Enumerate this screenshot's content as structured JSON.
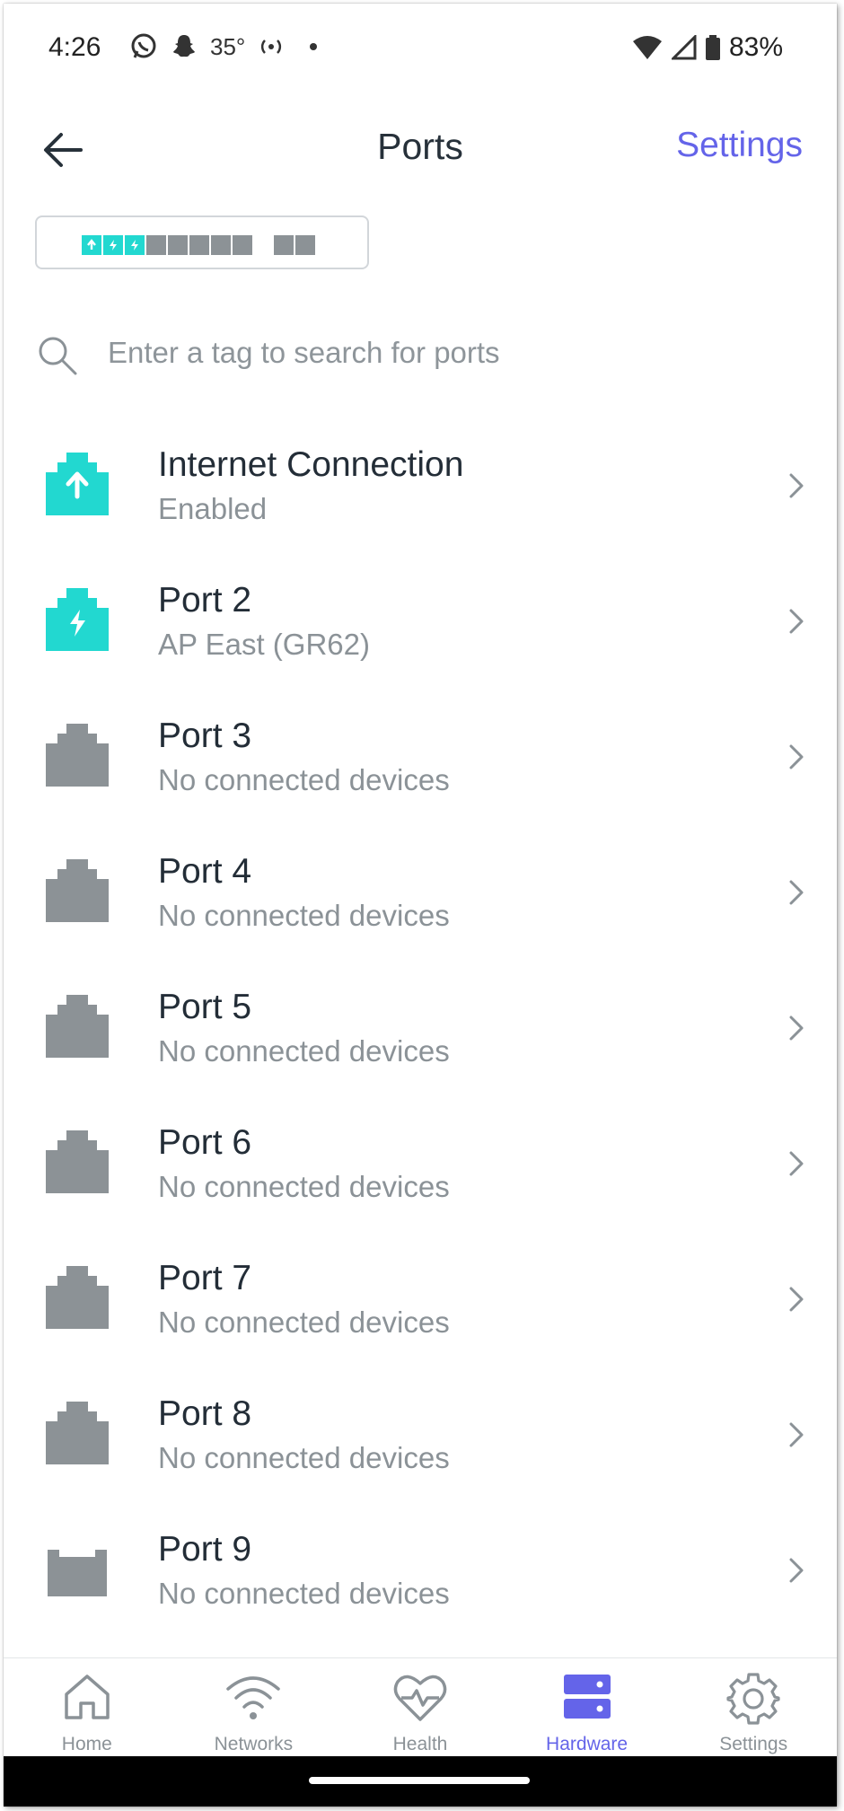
{
  "status_bar": {
    "time": "4:26",
    "temperature": "35°",
    "battery": "83%"
  },
  "header": {
    "title": "Ports",
    "settings_label": "Settings"
  },
  "port_strip": {
    "active_ports": [
      "upload",
      "power",
      "power"
    ],
    "inactive_count": 5,
    "extra_count": 2
  },
  "search": {
    "placeholder": "Enter a tag to search for ports"
  },
  "ports": [
    {
      "title": "Internet Connection",
      "subtitle": "Enabled",
      "icon": "upload-port-icon",
      "active": true
    },
    {
      "title": "Port 2",
      "subtitle": "AP East (GR62)",
      "icon": "power-port-icon",
      "active": true
    },
    {
      "title": "Port 3",
      "subtitle": "No connected devices",
      "icon": "ethernet-port-icon",
      "active": false
    },
    {
      "title": "Port 4",
      "subtitle": "No connected devices",
      "icon": "ethernet-port-icon",
      "active": false
    },
    {
      "title": "Port 5",
      "subtitle": "No connected devices",
      "icon": "ethernet-port-icon",
      "active": false
    },
    {
      "title": "Port 6",
      "subtitle": "No connected devices",
      "icon": "ethernet-port-icon",
      "active": false
    },
    {
      "title": "Port 7",
      "subtitle": "No connected devices",
      "icon": "ethernet-port-icon",
      "active": false
    },
    {
      "title": "Port 8",
      "subtitle": "No connected devices",
      "icon": "ethernet-port-icon",
      "active": false
    },
    {
      "title": "Port 9",
      "subtitle": "No connected devices",
      "icon": "sfp-port-icon",
      "active": false
    }
  ],
  "bottom_nav": {
    "items": [
      {
        "label": "Home",
        "icon": "home-icon"
      },
      {
        "label": "Networks",
        "icon": "wifi-icon"
      },
      {
        "label": "Health",
        "icon": "heart-pulse-icon"
      },
      {
        "label": "Hardware",
        "icon": "server-icon"
      },
      {
        "label": "Settings",
        "icon": "gear-icon"
      }
    ],
    "active_index": 3
  },
  "colors": {
    "accent": "#6464e9",
    "port_active": "#22d8d0",
    "port_inactive": "#8c9296",
    "title_text": "#232d37",
    "subtitle_text": "#8b9297"
  }
}
